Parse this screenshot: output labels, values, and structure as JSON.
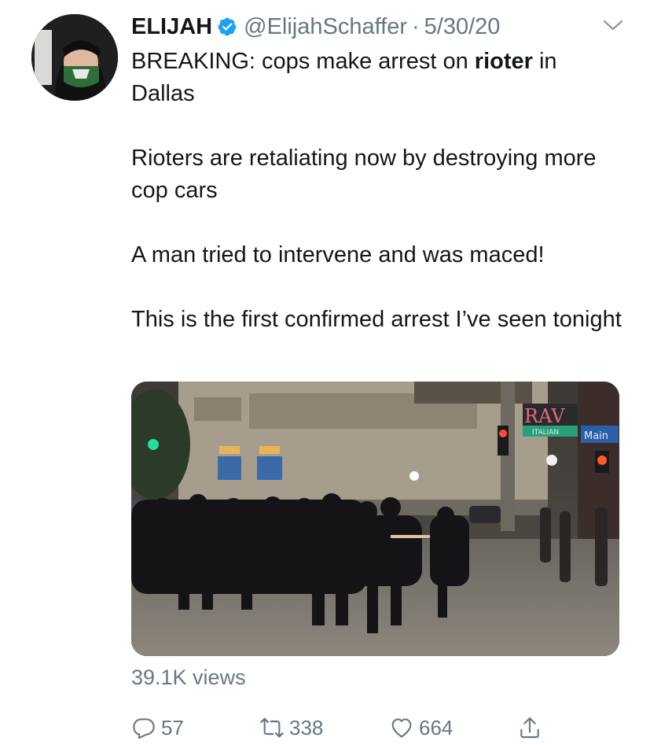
{
  "tweet": {
    "author": {
      "display_name": "ELIJAH",
      "handle": "@ElijahSchaffer",
      "separator": "·",
      "date": "5/30/20",
      "verified": true
    },
    "text": {
      "p1_prefix": "BREAKING: cops make arrest on ",
      "p1_bold": "rioter",
      "p1_suffix": " in Dallas",
      "p2": "Rioters are retaliating now by destroying more cop cars",
      "p3": "A man tried to intervene and was maced!",
      "p4": "This is the first confirmed arrest I’ve seen tonight"
    },
    "media": {
      "signs": {
        "rave": "RAV",
        "italian": "ITALIAN",
        "main": "Main"
      }
    },
    "views": "39.1K views",
    "actions": {
      "replies": "57",
      "retweets": "338",
      "likes": "664"
    }
  },
  "icons": {
    "menu": "chevron-down-icon",
    "verified": "verified-badge-icon",
    "reply": "reply-icon",
    "retweet": "retweet-icon",
    "like": "heart-icon",
    "share": "share-icon"
  },
  "colors": {
    "text": "#14171a",
    "secondary": "#657786",
    "verified": "#1da1f2"
  }
}
